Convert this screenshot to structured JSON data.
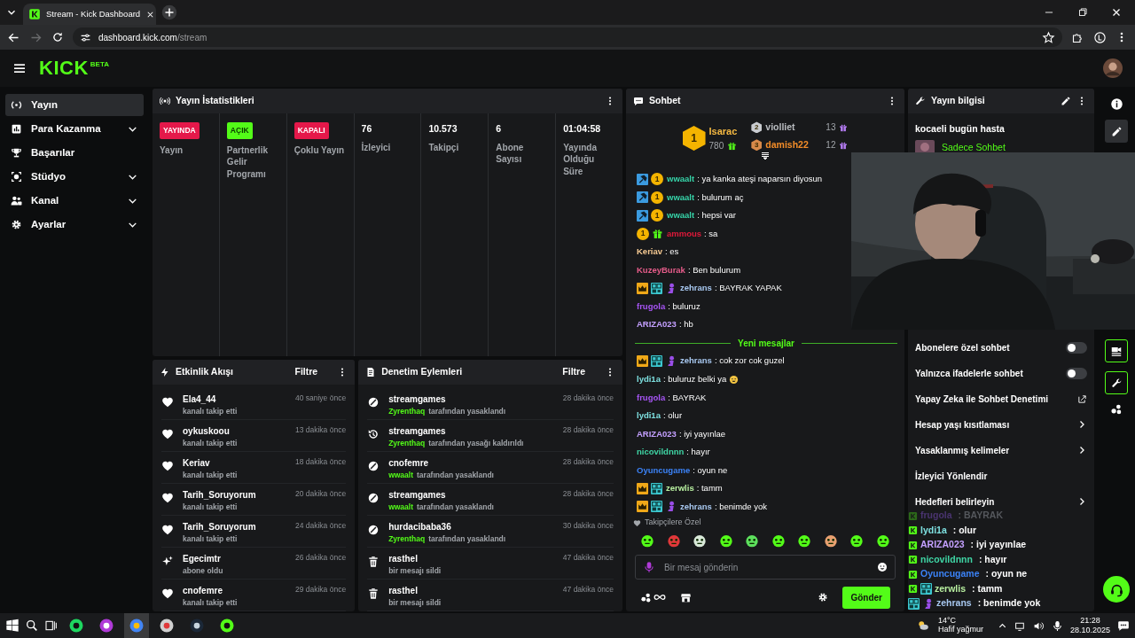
{
  "browser": {
    "tab_title": "Stream - Kick Dashboard",
    "url_host": "dashboard.kick.com",
    "url_path": "/stream"
  },
  "header": {
    "logo": "KICK",
    "logo_badge": "BETA"
  },
  "sidebar": {
    "items": [
      {
        "label": "Yayın",
        "selected": true,
        "expandable": false
      },
      {
        "label": "Para Kazanma",
        "selected": false,
        "expandable": true
      },
      {
        "label": "Başarılar",
        "selected": false,
        "expandable": false
      },
      {
        "label": "Stüdyo",
        "selected": false,
        "expandable": true
      },
      {
        "label": "Kanal",
        "selected": false,
        "expandable": true
      },
      {
        "label": "Ayarlar",
        "selected": false,
        "expandable": true
      }
    ]
  },
  "stats": {
    "title": "Yayın İstatistikleri",
    "cells": [
      {
        "kind": "live",
        "badge": "YAYINDA",
        "label": "Yayın"
      },
      {
        "kind": "on",
        "badge": "AÇIK",
        "label": "Partnerlik Gelir Programı"
      },
      {
        "kind": "off",
        "badge": "KAPALI",
        "label": "Çoklu Yayın"
      },
      {
        "kind": "metric",
        "value": "76",
        "label": "İzleyici"
      },
      {
        "kind": "metric",
        "value": "10.573",
        "label": "Takipçi"
      },
      {
        "kind": "metric",
        "value": "6",
        "label": "Abone Sayısı"
      },
      {
        "kind": "metric",
        "value": "01:04:58",
        "label": "Yayında Olduğu Süre"
      }
    ]
  },
  "events": {
    "title": "Etkinlik Akışı",
    "filter": "Filtre",
    "items": [
      {
        "kind": "follow",
        "user": "Ela4_44",
        "action": "kanalı takip etti",
        "time": "40 saniye önce"
      },
      {
        "kind": "follow",
        "user": "oykuskoou",
        "action": "kanalı takip etti",
        "time": "13 dakika önce"
      },
      {
        "kind": "follow",
        "user": "Keriav",
        "action": "kanalı takip etti",
        "time": "18 dakika önce"
      },
      {
        "kind": "follow",
        "user": "Tarih_Soruyorum",
        "action": "kanalı takip etti",
        "time": "20 dakika önce"
      },
      {
        "kind": "follow",
        "user": "Tarih_Soruyorum",
        "action": "kanalı takip etti",
        "time": "24 dakika önce"
      },
      {
        "kind": "subscribe",
        "user": "Egecimtr",
        "action": "abone oldu",
        "time": "26 dakika önce"
      },
      {
        "kind": "follow",
        "user": "cnofemre",
        "action": "kanalı takip etti",
        "time": "29 dakika önce"
      }
    ]
  },
  "moderation": {
    "title": "Denetim Eylemleri",
    "filter": "Filtre",
    "items": [
      {
        "kind": "ban",
        "user": "streamgames",
        "moderator": "Zyrenthaq",
        "action": "tarafından yasaklandı",
        "time": "28 dakika önce"
      },
      {
        "kind": "unban",
        "user": "streamgames",
        "moderator": "Zyrenthaq",
        "action": "tarafından yasağı kaldırıldı",
        "time": "28 dakika önce"
      },
      {
        "kind": "ban",
        "user": "cnofemre",
        "moderator": "wwaalt",
        "action": "tarafından yasaklandı",
        "time": "28 dakika önce"
      },
      {
        "kind": "ban",
        "user": "streamgames",
        "moderator": "wwaalt",
        "action": "tarafından yasaklandı",
        "time": "28 dakika önce"
      },
      {
        "kind": "ban",
        "user": "hurdacibaba36",
        "moderator": "Zyrenthaq",
        "action": "tarafından yasaklandı",
        "time": "30 dakika önce"
      },
      {
        "kind": "delete",
        "user": "rasthel",
        "action": "bir mesajı sildi",
        "time": "47 dakika önce"
      },
      {
        "kind": "delete",
        "user": "rasthel",
        "action": "bir mesajı sildi",
        "time": "47 dakika önce"
      }
    ]
  },
  "chat": {
    "title": "Sohbet",
    "leaderboard": [
      {
        "rank": "1",
        "name": "Isarac",
        "count": "780",
        "color": "#f5b942"
      },
      {
        "rank": "2",
        "name": "violliet",
        "count": "13",
        "color": "#b9bcc0"
      },
      {
        "rank": "3",
        "name": "damish22",
        "count": "12",
        "color": "#f28c28"
      }
    ],
    "messages": [
      {
        "kind": "message",
        "user": "wwaalt",
        "color": "#36d3a8",
        "text": ": ya kanka ateşi naparsın diyosun",
        "badges": [
          {
            "kind": "mod"
          },
          {
            "kind": "sub",
            "text": "1"
          }
        ]
      },
      {
        "kind": "message",
        "user": "wwaalt",
        "color": "#36d3a8",
        "text": ": bulurum aç",
        "badges": [
          {
            "kind": "mod"
          },
          {
            "kind": "sub",
            "text": "1"
          }
        ]
      },
      {
        "kind": "message",
        "user": "wwaalt",
        "color": "#36d3a8",
        "text": ": hepsi var",
        "badges": [
          {
            "kind": "mod"
          },
          {
            "kind": "sub",
            "text": "1"
          }
        ]
      },
      {
        "kind": "message",
        "user": "ammous",
        "color": "#e0193a",
        "text": ": sa",
        "badges": [
          {
            "kind": "sub",
            "text": "1"
          },
          {
            "kind": "gift"
          }
        ]
      },
      {
        "kind": "message",
        "user": "Keriav",
        "color": "#f5c992",
        "text": ": es"
      },
      {
        "kind": "message",
        "user": "KuzeyBurak",
        "color": "#e65c8a",
        "text": ": Ben bulurum"
      },
      {
        "kind": "message",
        "user": "zehrans",
        "color": "#a8c8f0",
        "text": ": BAYRAK YAPAK",
        "badges": [
          {
            "kind": "crown"
          },
          {
            "kind": "og"
          },
          {
            "kind": "figure"
          }
        ]
      },
      {
        "kind": "message",
        "user": "frugola",
        "color": "#a855f7",
        "text": ": buluruz"
      },
      {
        "kind": "message",
        "user": "ARIZA023",
        "color": "#c4a0ff",
        "text": ": hb"
      },
      {
        "kind": "divider",
        "text": "Yeni mesajlar"
      },
      {
        "kind": "message",
        "user": "zehrans",
        "color": "#a8c8f0",
        "text": ": cok zor cok guzel",
        "badges": [
          {
            "kind": "crown"
          },
          {
            "kind": "og"
          },
          {
            "kind": "figure"
          }
        ]
      },
      {
        "kind": "message",
        "user": "lydi1a",
        "color": "#7ee0e0",
        "text": ": buluruz belki ya",
        "emote": true
      },
      {
        "kind": "message",
        "user": "frugola",
        "color": "#a855f7",
        "text": ": BAYRAK"
      },
      {
        "kind": "message",
        "user": "lydi1a",
        "color": "#7ee0e0",
        "text": ": olur"
      },
      {
        "kind": "message",
        "user": "ARIZA023",
        "color": "#c4a0ff",
        "text": ": iyi yayınlae"
      },
      {
        "kind": "message",
        "user": "nicovildnnn",
        "color": "#3fd6a5",
        "text": ": hayır"
      },
      {
        "kind": "message",
        "user": "Oyuncugame",
        "color": "#3b82f6",
        "text": ": oyun ne"
      },
      {
        "kind": "message",
        "user": "zerwlis",
        "color": "#b8f0a0",
        "text": ": tamm",
        "badges": [
          {
            "kind": "crown"
          },
          {
            "kind": "og"
          }
        ]
      },
      {
        "kind": "message",
        "user": "zehrans",
        "color": "#a8c8f0",
        "text": ": benimde yok",
        "badges": [
          {
            "kind": "crown"
          },
          {
            "kind": "og"
          },
          {
            "kind": "figure"
          }
        ]
      }
    ],
    "emotes_label": "Takipçilere Özel",
    "placeholder": "Bir mesaj gönderin",
    "send": "Gönder"
  },
  "stream_info": {
    "title": "Yayın bilgisi",
    "stream_title": "kocaeli bugün hasta",
    "category": "Sadece Sohbet",
    "settings": [
      {
        "kind": "toggle",
        "label": "Abonelere özel sohbet",
        "on": false
      },
      {
        "kind": "toggle",
        "label": "Yalnızca ifadelerle sohbet",
        "on": false
      },
      {
        "kind": "external",
        "label": "Yapay Zeka ile Sohbet Denetimi"
      },
      {
        "kind": "submenu",
        "label": "Hesap yaşı kısıtlaması"
      },
      {
        "kind": "submenu",
        "label": "Yasaklanmış kelimeler"
      },
      {
        "kind": "plain",
        "label": "İzleyici Yönlendir"
      },
      {
        "kind": "submenu",
        "label": "Hedefleri belirleyin"
      }
    ]
  },
  "overlay_chat": [
    {
      "user": "frugola",
      "color": "#4a3470",
      "text": ": BAYRAK",
      "faded": true,
      "badges": [
        {
          "kind": "kick"
        }
      ]
    },
    {
      "user": "lydi1a",
      "color": "#7ee0e0",
      "text": ": olur",
      "faded": false,
      "badges": [
        {
          "kind": "kick"
        }
      ]
    },
    {
      "user": "ARIZA023",
      "color": "#c4a0ff",
      "text": ": iyi yayınlae",
      "faded": false,
      "badges": [
        {
          "kind": "kick"
        }
      ]
    },
    {
      "user": "nicovildnnn",
      "color": "#3fd6a5",
      "text": ": hayır",
      "faded": false,
      "badges": [
        {
          "kind": "kick"
        }
      ]
    },
    {
      "user": "Oyuncugame",
      "color": "#3b82f6",
      "text": ": oyun ne",
      "faded": false,
      "badges": [
        {
          "kind": "kick"
        }
      ]
    },
    {
      "user": "zerwlis",
      "color": "#b8f0a0",
      "text": ": tamm",
      "faded": false,
      "badges": [
        {
          "kind": "kick"
        },
        {
          "kind": "og"
        }
      ]
    },
    {
      "user": "zehrans",
      "color": "#a8c8f0",
      "text": ": benimde yok",
      "faded": false,
      "badges": [
        {
          "kind": "og"
        },
        {
          "kind": "figure"
        }
      ]
    }
  ],
  "taskbar": {
    "weather_temp": "14°C",
    "weather_text": "Hafif yağmur",
    "time": "21:28",
    "date": "28.10.2025"
  }
}
